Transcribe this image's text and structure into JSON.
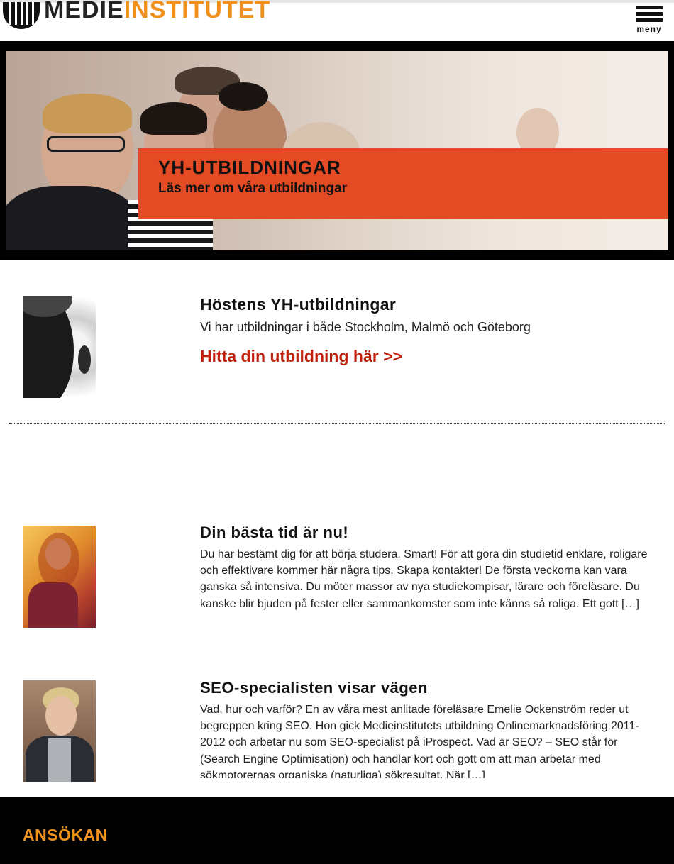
{
  "header": {
    "logo_part1": "MEDIE",
    "logo_part2": "INSTITUTET",
    "menu_label": "meny"
  },
  "hero": {
    "title": "YH-UTBILDNINGAR",
    "subtitle": "Läs mer om våra utbildningar"
  },
  "featured": {
    "title": "Höstens YH-utbildningar",
    "text": "Vi har utbildningar i både Stockholm, Malmö och Göteborg",
    "link": "Hitta din utbildning här >>"
  },
  "articles": [
    {
      "title": "Din bästa tid är nu!",
      "excerpt": "Du har bestämt dig för att börja studera. Smart! För att göra din studietid enklare, roligare och effektivare kommer här några tips. Skapa kontakter! De första veckorna kan vara ganska så intensiva. Du möter massor av nya studiekompisar, lärare och föreläsare. Du kanske blir bjuden på fester eller sammankomster som inte känns så roliga. Ett gott […]"
    },
    {
      "title": "SEO-specialisten visar vägen",
      "excerpt": "Vad, hur och varför? En av våra mest anlitade föreläsare Emelie Ockenström reder ut begreppen kring SEO. Hon gick Medieinstitutets utbildning Onlinemarknadsföring 2011-2012 och arbetar nu som SEO-specialist på iProspect. Vad är SEO? – SEO står för (Search Engine Optimisation) och handlar kort och gott om att man arbetar med sökmotorernas organiska (naturliga) sökresultat. När […]"
    }
  ],
  "footer": {
    "title": "ANSÖKAN"
  },
  "colors": {
    "accent_orange": "#f0901d",
    "hero_box": "#e44b25",
    "link_red": "#c0220e"
  }
}
